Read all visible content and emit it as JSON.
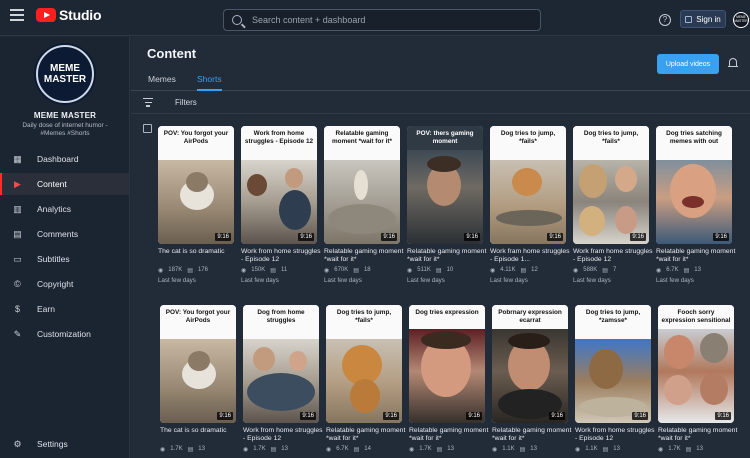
{
  "topbar": {
    "logo_text": "Studio",
    "search_placeholder": "Search content + dashboard",
    "help_label": "?",
    "signin_label": "Sign in",
    "avatar_text": "MEME MASTER"
  },
  "sidebar": {
    "avatar_line1": "MEME",
    "avatar_line2": "MASTER",
    "channel_name": "MEME MASTER",
    "channel_desc": "Daily dose of internet humor - #Memes #Shorts",
    "items": [
      {
        "label": "Dashboard",
        "icon": "dashboard-icon",
        "glyph": "▦"
      },
      {
        "label": "Content",
        "icon": "content-icon",
        "glyph": "▶"
      },
      {
        "label": "Analytics",
        "icon": "analytics-icon",
        "glyph": "▥"
      },
      {
        "label": "Comments",
        "icon": "comments-icon",
        "glyph": "▤"
      },
      {
        "label": "Subtitles",
        "icon": "subtitles-icon",
        "glyph": "▭"
      },
      {
        "label": "Copyright",
        "icon": "copyright-icon",
        "glyph": "©"
      },
      {
        "label": "Earn",
        "icon": "earn-icon",
        "glyph": "$"
      },
      {
        "label": "Customization",
        "icon": "customization-icon",
        "glyph": "✎"
      }
    ],
    "settings_label": "Settings",
    "settings_glyph": "⚙"
  },
  "main": {
    "title": "Content",
    "upload_label": "Upload videos",
    "tabs": [
      {
        "label": "Memes"
      },
      {
        "label": "Shorts"
      }
    ],
    "filters_label": "Filters"
  },
  "row1": [
    {
      "caption": "POV: You forgot your AirPods",
      "duration": "9:16",
      "title": "The cat is so dramatic",
      "views": "187K",
      "comments": "176",
      "date": "Last few days"
    },
    {
      "caption": "Work from home struggles - Episode 12",
      "duration": "9:16",
      "title": "Work from home struggles - Episode 12",
      "views": "150K",
      "comments": "11",
      "date": "Last few days"
    },
    {
      "caption": "Relatable gaming moment *wait for it*",
      "duration": "9:16",
      "title": "Relatable gaming moment *wait for it*",
      "views": "670K",
      "comments": "18",
      "date": "Last few days"
    },
    {
      "caption": "POV: thers gaming moment",
      "duration": "9:16",
      "title": "Relatable gaming moment *wait for it*",
      "views": "511K",
      "comments": "10",
      "date": "Last few days"
    },
    {
      "caption": "Dog tries to jump, *fails*",
      "duration": "9:16",
      "title": "Work fram home struggles - Episode 1...",
      "views": "4.11K",
      "comments": "12",
      "date": "Last few days"
    },
    {
      "caption": "Dog tries to jump, *fails*",
      "duration": "9:16",
      "title": "Work fram home struggles - Episode 12",
      "views": "588K",
      "comments": "7",
      "date": "Last few days"
    },
    {
      "caption": "Dog tries satching memes with out",
      "duration": "9:16",
      "title": "Relatable gaming moment *wait for it*",
      "views": "6.7K",
      "comments": "13",
      "date": "Last few days"
    }
  ],
  "row2": [
    {
      "caption": "POV: You forgot your AirPods",
      "duration": "9:16",
      "title": "The cat is so dramatic",
      "views": "1.7K",
      "comments": "13",
      "date": ""
    },
    {
      "caption": "Dog from home struggles",
      "duration": "9:16",
      "title": "Work from home struggles - Episode 12",
      "views": "1.7K",
      "comments": "13",
      "date": ""
    },
    {
      "caption": "Dog tries to jump, *fails*",
      "duration": "9:16",
      "title": "Relatable gaming moment *wait for it*",
      "views": "6.7K",
      "comments": "14",
      "date": ""
    },
    {
      "caption": "Dog tries expression",
      "duration": "9:16",
      "title": "Relatable gaming moment *wait for it*",
      "views": "1.7K",
      "comments": "13",
      "date": ""
    },
    {
      "caption": "Pobrnary expression ecarrat",
      "duration": "9:16",
      "title": "Relatable gaming moment *wait for it*",
      "views": "1.1K",
      "comments": "13",
      "date": ""
    },
    {
      "caption": "Dog tries to jump, *zamsse*",
      "duration": "9:16",
      "title": "Work from home struggles - Episode 12",
      "views": "1.1K",
      "comments": "13",
      "date": ""
    },
    {
      "caption": "Fooch sorry expression sensitional",
      "duration": "9:16",
      "title": "Relatable gaming moment *wait for it*",
      "views": "1.7K",
      "comments": "13",
      "date": ""
    }
  ],
  "icons": {
    "views": "views-icon",
    "comments": "comments-count-icon"
  }
}
